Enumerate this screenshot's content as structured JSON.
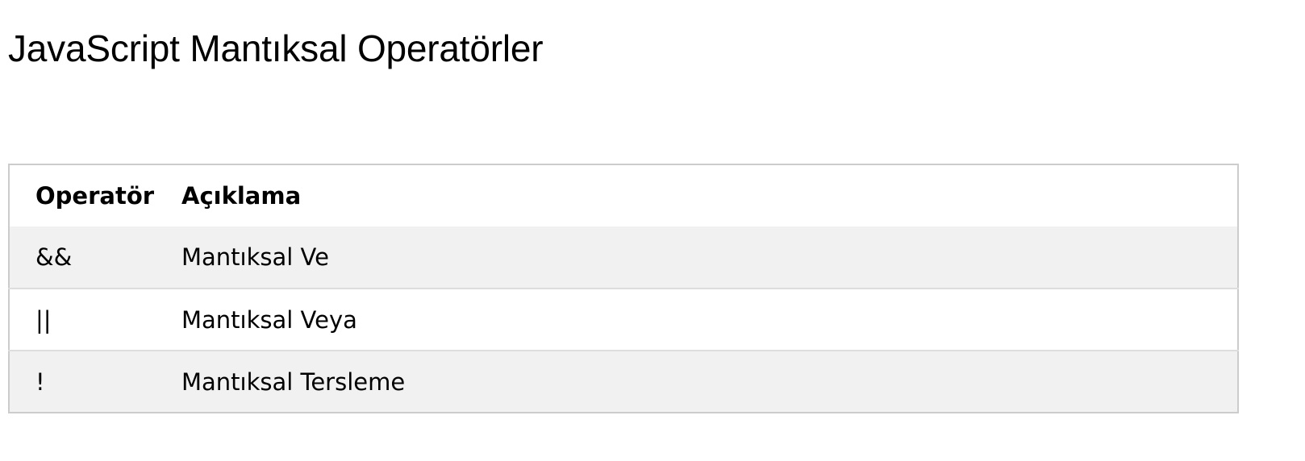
{
  "page": {
    "title": "JavaScript Mantıksal Operatörler"
  },
  "table": {
    "headers": {
      "operator": "Operatör",
      "description": "Açıklama"
    },
    "rows": [
      {
        "operator": "&&",
        "description": "Mantıksal Ve"
      },
      {
        "operator": "||",
        "description": "Mantıksal Veya"
      },
      {
        "operator": "!",
        "description": "Mantıksal Tersleme"
      }
    ]
  },
  "colors": {
    "border": "#cccccc",
    "row_divider": "#dddddd",
    "striped_row": "#f1f1f1",
    "background": "#ffffff",
    "text": "#000000"
  }
}
